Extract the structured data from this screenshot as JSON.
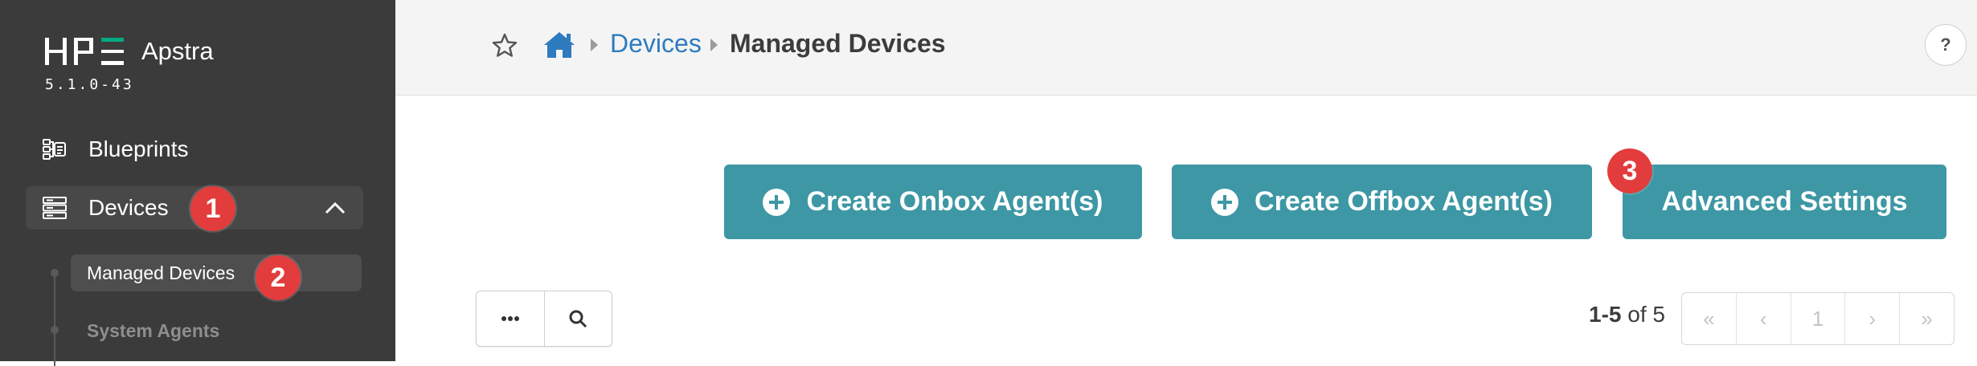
{
  "sidebar": {
    "product_name": "Apstra",
    "version": "5.1.0-43",
    "items": [
      {
        "label": "Blueprints"
      },
      {
        "label": "Devices"
      }
    ],
    "sub_items": [
      {
        "label": "Managed Devices"
      },
      {
        "label": "System Agents"
      }
    ]
  },
  "header": {
    "breadcrumb_parent": "Devices",
    "breadcrumb_current": "Managed Devices",
    "help_label": "?"
  },
  "actions": {
    "create_onbox": "Create Onbox Agent(s)",
    "create_offbox": "Create Offbox Agent(s)",
    "advanced_settings": "Advanced Settings"
  },
  "pagination": {
    "range": "1-5",
    "of_label": "of",
    "total": "5",
    "current_page": "1",
    "first": "«",
    "prev": "‹",
    "next": "›",
    "last": "»"
  },
  "annotations": [
    "1",
    "2",
    "3"
  ],
  "colors": {
    "sidebar_bg": "#3b3b3b",
    "accent_teal": "#3d97a4",
    "link_blue": "#2f7bbf",
    "badge_red": "#e23c3c",
    "hpe_green": "#01a982"
  }
}
